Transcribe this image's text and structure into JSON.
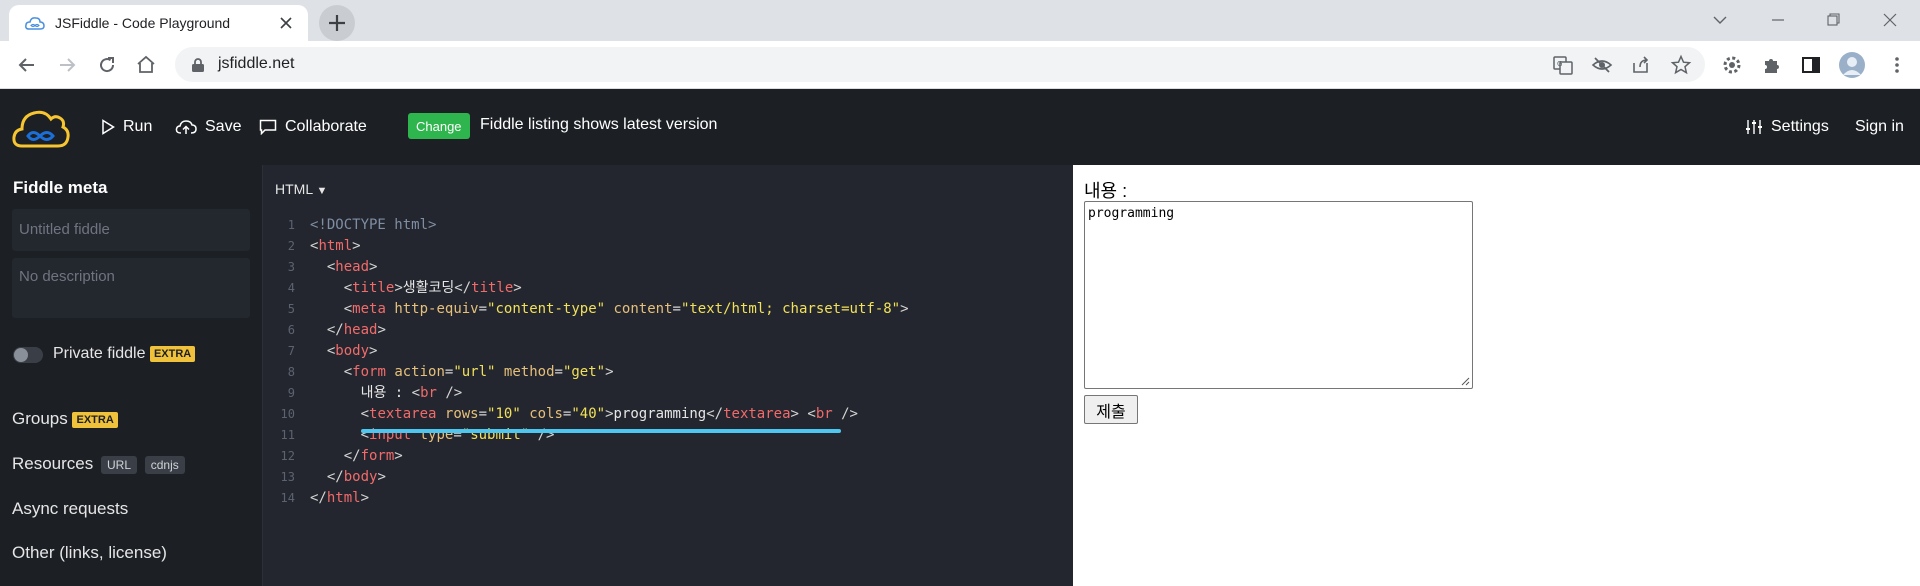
{
  "browser": {
    "tab_title": "JSFiddle - Code Playground",
    "url": "jsfiddle.net"
  },
  "header": {
    "run_label": "Run",
    "save_label": "Save",
    "collaborate_label": "Collaborate",
    "change_badge": "Change",
    "change_text": "Fiddle listing shows latest version",
    "settings_label": "Settings",
    "signin_label": "Sign in"
  },
  "sidebar": {
    "title": "Fiddle meta",
    "title_placeholder": "Untitled fiddle",
    "description_placeholder": "No description",
    "private_label": "Private fiddle",
    "extra_badge": "EXTRA",
    "groups_label": "Groups",
    "resources_label": "Resources",
    "resources_chips": [
      "URL",
      "cdnjs"
    ],
    "async_label": "Async requests",
    "other_label": "Other (links, license)"
  },
  "editor": {
    "language": "HTML",
    "line_numbers": [
      "1",
      "2",
      "3",
      "4",
      "5",
      "6",
      "7",
      "8",
      "9",
      "10",
      "11",
      "12",
      "13",
      "14"
    ]
  },
  "result": {
    "label": "내용 :",
    "textarea_value": "programming",
    "submit_label": "제출"
  },
  "colors": {
    "header_bg": "#1c1f24",
    "editor_bg": "#23262e",
    "change_green": "#2fb54d",
    "extra_yellow": "#f0c13a",
    "logo_blue": "#1b6fd6",
    "logo_yellow": "#f7c531",
    "underline_cyan": "#4ec7f0"
  }
}
